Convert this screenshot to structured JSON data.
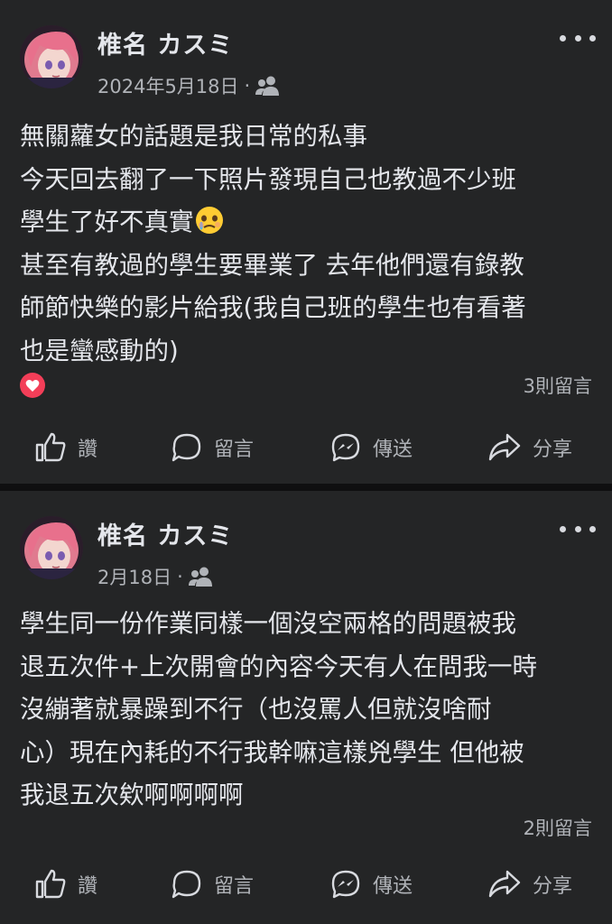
{
  "posts": [
    {
      "author": "椎名 カスミ",
      "date": "2024年5月18日",
      "separator": "·",
      "audience_icon": "friends-icon",
      "lines": [
        "無關蘿女的話題是我日常的私事",
        "今天回去翻了一下照片發現自己也教過不少班",
        "學生了好不真實",
        "甚至有教過的學生要畢業了 去年他們還有錄教",
        "師節快樂的影片給我(我自己班的學生也有看著",
        "也是蠻感動的)"
      ],
      "inline_emoji": "face-holding-back-tears",
      "reaction": "love",
      "comment_count": "3則留言",
      "actions": {
        "like": "讚",
        "comment": "留言",
        "send": "傳送",
        "share": "分享"
      }
    },
    {
      "author": "椎名 カスミ",
      "date": "2月18日",
      "separator": "·",
      "audience_icon": "friends-icon",
      "lines": [
        "學生同一份作業同樣一個沒空兩格的問題被我",
        "退五次件+上次開會的內容今天有人在問我一時",
        "沒繃著就暴躁到不行（也沒罵人但就沒啥耐",
        "心）現在內耗的不行我幹嘛這樣兇學生 但他被",
        "我退五次欸啊啊啊啊"
      ],
      "comment_count": "2則留言",
      "actions": {
        "like": "讚",
        "comment": "留言",
        "send": "傳送",
        "share": "分享"
      }
    }
  ],
  "colors": {
    "page_bg": "#0f0f10",
    "card_bg": "#242526",
    "primary_text": "#e4e6eb",
    "secondary_text": "#b0b3b8",
    "love": "#f33e58"
  }
}
